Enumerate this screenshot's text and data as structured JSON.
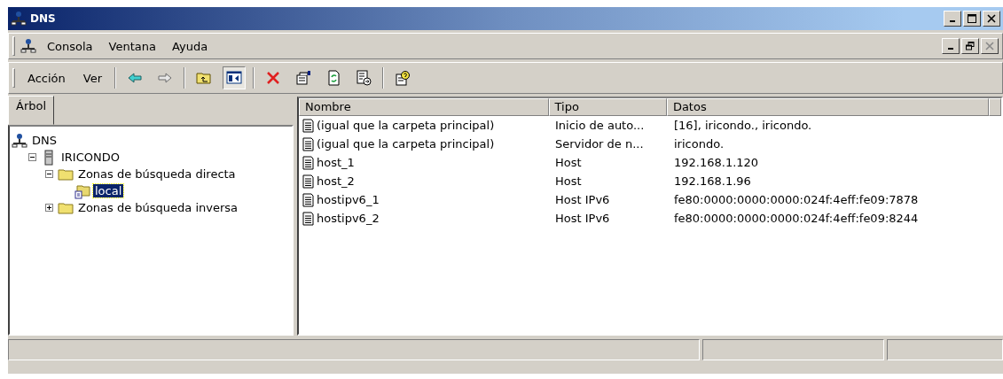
{
  "window": {
    "title": "DNS"
  },
  "menu": [
    {
      "label": "Consola"
    },
    {
      "label": "Ventana"
    },
    {
      "label": "Ayuda"
    }
  ],
  "action_menu": [
    {
      "label": "Acción"
    },
    {
      "label": "Ver"
    }
  ],
  "toolbar": [
    {
      "kind": "back",
      "disabled": false,
      "pressed": false
    },
    {
      "kind": "forward",
      "disabled": true,
      "pressed": false
    },
    {
      "kind": "up",
      "disabled": false,
      "pressed": false
    },
    {
      "kind": "tree",
      "disabled": false,
      "pressed": true
    },
    {
      "kind": "delete",
      "disabled": false,
      "pressed": false
    },
    {
      "kind": "properties",
      "disabled": false,
      "pressed": false
    },
    {
      "kind": "refresh",
      "disabled": false,
      "pressed": false
    },
    {
      "kind": "export",
      "disabled": false,
      "pressed": false
    },
    {
      "kind": "help",
      "disabled": false,
      "pressed": false
    }
  ],
  "tree_tab": {
    "label": "Árbol"
  },
  "tree": [
    {
      "label": "DNS",
      "kind": "root",
      "selected": false,
      "children": [
        {
          "label": "IRICONDO",
          "kind": "server",
          "selected": false,
          "expanded": true,
          "children": [
            {
              "label": "Zonas de búsqueda directa",
              "kind": "folder",
              "selected": false,
              "expanded": true,
              "children": [
                {
                  "label": "local",
                  "kind": "zone",
                  "selected": true
                }
              ]
            },
            {
              "label": "Zonas de búsqueda inversa",
              "kind": "folder",
              "selected": false,
              "expanded": false
            }
          ]
        }
      ]
    }
  ],
  "table": {
    "columns": [
      "Nombre",
      "Tipo",
      "Datos"
    ],
    "rows": [
      [
        "(igual que la carpeta principal)",
        "Inicio de auto...",
        "[16], iricondo., iricondo."
      ],
      [
        "(igual que la carpeta principal)",
        "Servidor de n...",
        "iricondo."
      ],
      [
        "host_1",
        "Host",
        "192.168.1.120"
      ],
      [
        "host_2",
        "Host",
        "192.168.1.96"
      ],
      [
        "hostipv6_1",
        "Host IPv6",
        "fe80:0000:0000:0000:024f:4eff:fe09:7878"
      ],
      [
        "hostipv6_2",
        "Host IPv6",
        "fe80:0000:0000:0000:024f:4eff:fe09:8244"
      ]
    ]
  }
}
